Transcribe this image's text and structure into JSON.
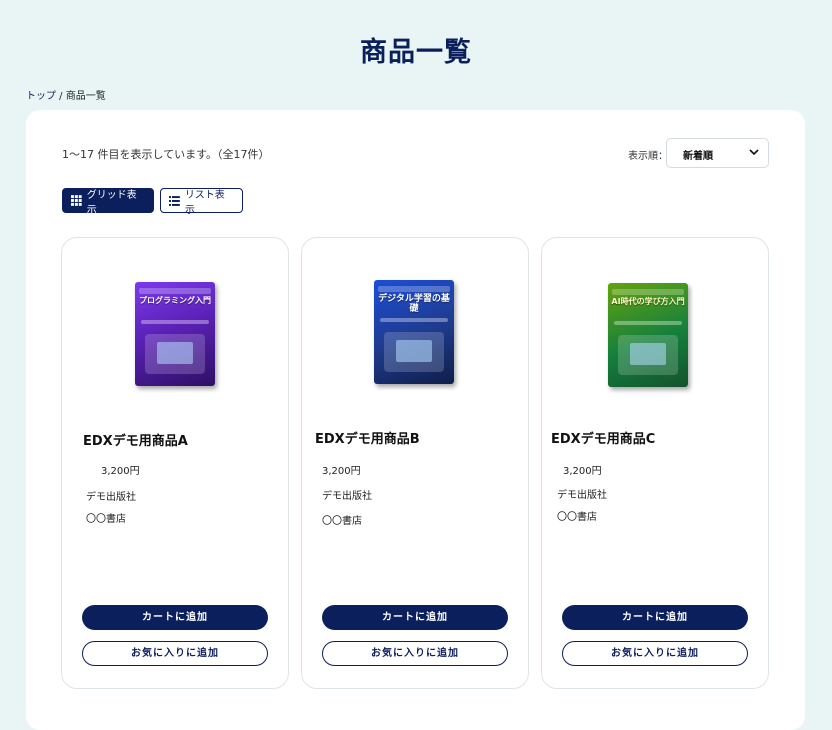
{
  "page": {
    "title": "商品一覧"
  },
  "breadcrumb": {
    "home": "トップ",
    "separator": " / ",
    "current": "商品一覧"
  },
  "results": {
    "summary": "1～17 件目を表示しています。（全17件）"
  },
  "sort": {
    "label": "表示順：",
    "selected": "新着順"
  },
  "view_toggle": {
    "grid_label": "グリッド表示",
    "list_label": "リスト表示",
    "active": "grid"
  },
  "products": [
    {
      "name": "EDXデモ用商品A",
      "price": "3,200円",
      "publisher": "デモ出版社",
      "store": "〇〇書店",
      "cover_title": "プログラミング入門",
      "cart_label": "カートに追加",
      "fav_label": "お気に入りに追加"
    },
    {
      "name": "EDXデモ用商品B",
      "price": "3,200円",
      "publisher": "デモ出版社",
      "store": "〇〇書店",
      "cover_title": "デジタル学習の基礎",
      "cart_label": "カートに追加",
      "fav_label": "お気に入りに追加"
    },
    {
      "name": "EDXデモ用商品C",
      "price": "3,200円",
      "publisher": "デモ出版社",
      "store": "〇〇書店",
      "cover_title": "AI時代の学び方入門",
      "cart_label": "カートに追加",
      "fav_label": "お気に入りに追加"
    }
  ],
  "colors": {
    "brand": "#0b1f5c",
    "background": "#e9f5f5",
    "panel": "#ffffff"
  },
  "icons": {
    "grid": "grid-icon",
    "list": "list-icon",
    "sort": "chevron-down-icon"
  }
}
